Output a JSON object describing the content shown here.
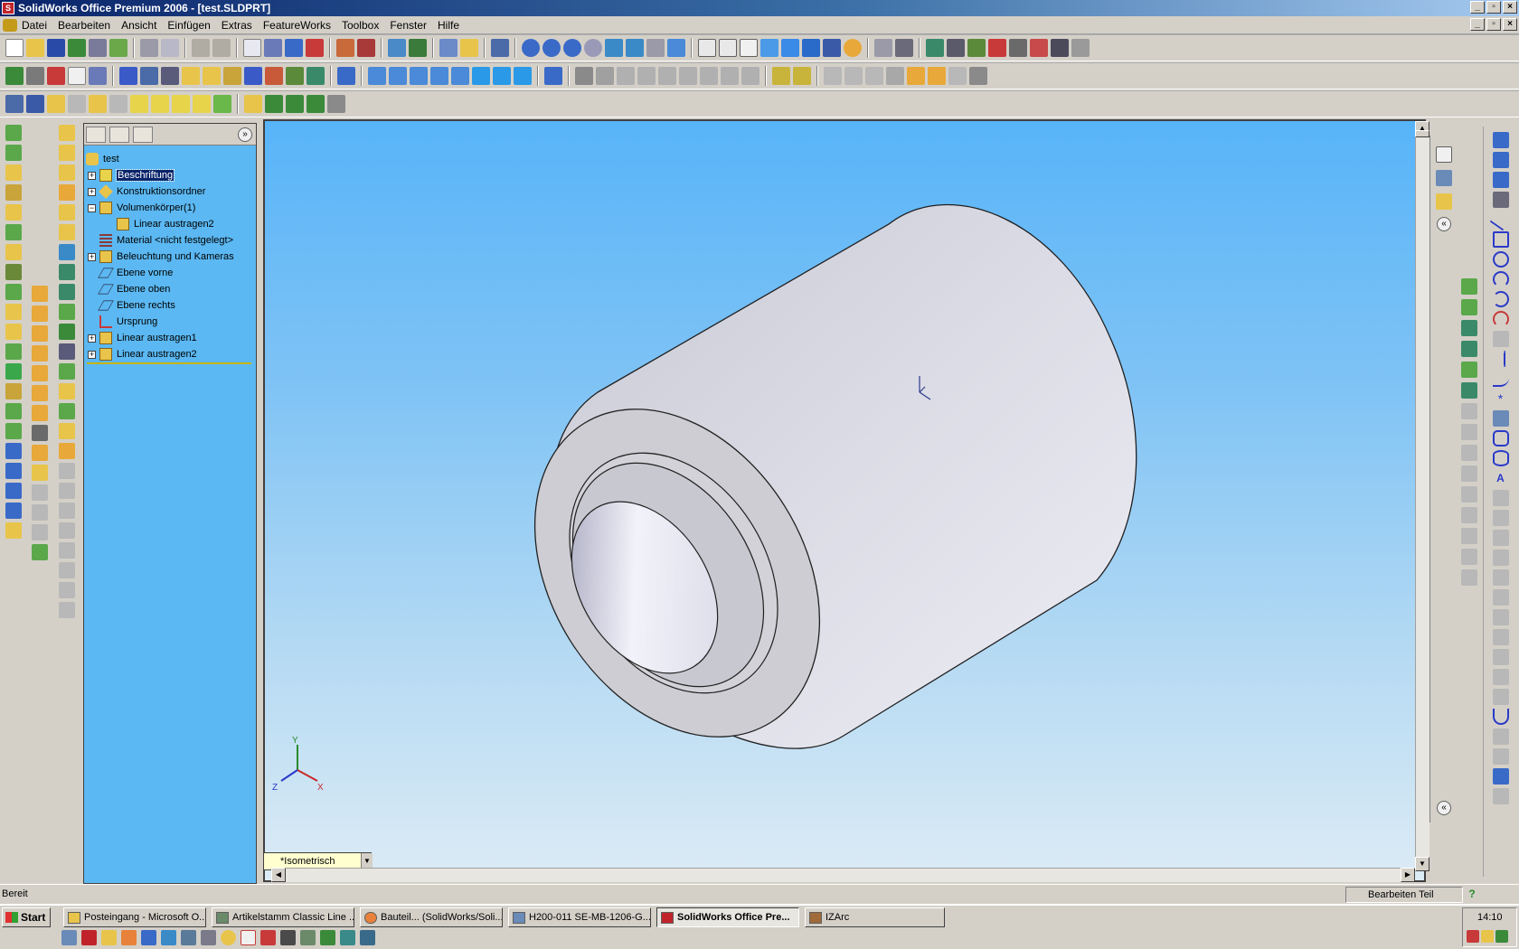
{
  "window": {
    "title": "SolidWorks Office Premium 2006 - [test.SLDPRT]"
  },
  "menu": {
    "items": [
      "Datei",
      "Bearbeiten",
      "Ansicht",
      "Einfügen",
      "Extras",
      "FeatureWorks",
      "Toolbox",
      "Fenster",
      "Hilfe"
    ]
  },
  "feature_tree": {
    "root": "test",
    "items": [
      {
        "label": "Beschriftung",
        "expandable": true,
        "selected": true,
        "icon": "annotation-icon"
      },
      {
        "label": "Konstruktionsordner",
        "expandable": true,
        "icon": "design-folder-icon"
      },
      {
        "label": "Volumenkörper(1)",
        "expandable": true,
        "expanded": true,
        "icon": "solid-bodies-icon"
      },
      {
        "label": "Linear austragen2",
        "child": true,
        "icon": "extrude-icon"
      },
      {
        "label": "Material <nicht festgelegt>",
        "icon": "material-icon"
      },
      {
        "label": "Beleuchtung und Kameras",
        "expandable": true,
        "icon": "lights-icon"
      },
      {
        "label": "Ebene vorne",
        "icon": "plane-icon"
      },
      {
        "label": "Ebene oben",
        "icon": "plane-icon"
      },
      {
        "label": "Ebene rechts",
        "icon": "plane-icon"
      },
      {
        "label": "Ursprung",
        "icon": "origin-icon"
      },
      {
        "label": "Linear austragen1",
        "expandable": true,
        "icon": "extrude-icon"
      },
      {
        "label": "Linear austragen2",
        "expandable": true,
        "icon": "extrude-icon"
      }
    ]
  },
  "viewport": {
    "view_orientation": "*Isometrisch",
    "triad": {
      "x": "X",
      "y": "Y",
      "z": "Z"
    }
  },
  "statusbar": {
    "left": "Bereit",
    "right": "Bearbeiten Teil",
    "help": "?"
  },
  "taskbar": {
    "start": "Start",
    "tasks": [
      {
        "label": "Posteingang - Microsoft O...",
        "active": false
      },
      {
        "label": "Artikelstamm  Classic Line ...",
        "active": false
      },
      {
        "label": "Bauteil... (SolidWorks/Soli...",
        "active": false
      },
      {
        "label": "H200-011 SE-MB-1206-G...",
        "active": false
      },
      {
        "label": "SolidWorks Office Pre...",
        "active": true
      },
      {
        "label": "IZArc",
        "active": false
      }
    ],
    "clock": "14:10"
  },
  "colors": {
    "titlebar_start": "#0a246a",
    "viewport_top": "#58b4f8",
    "viewport_bottom": "#dcebf5",
    "tree_background": "#5bb8f2"
  }
}
